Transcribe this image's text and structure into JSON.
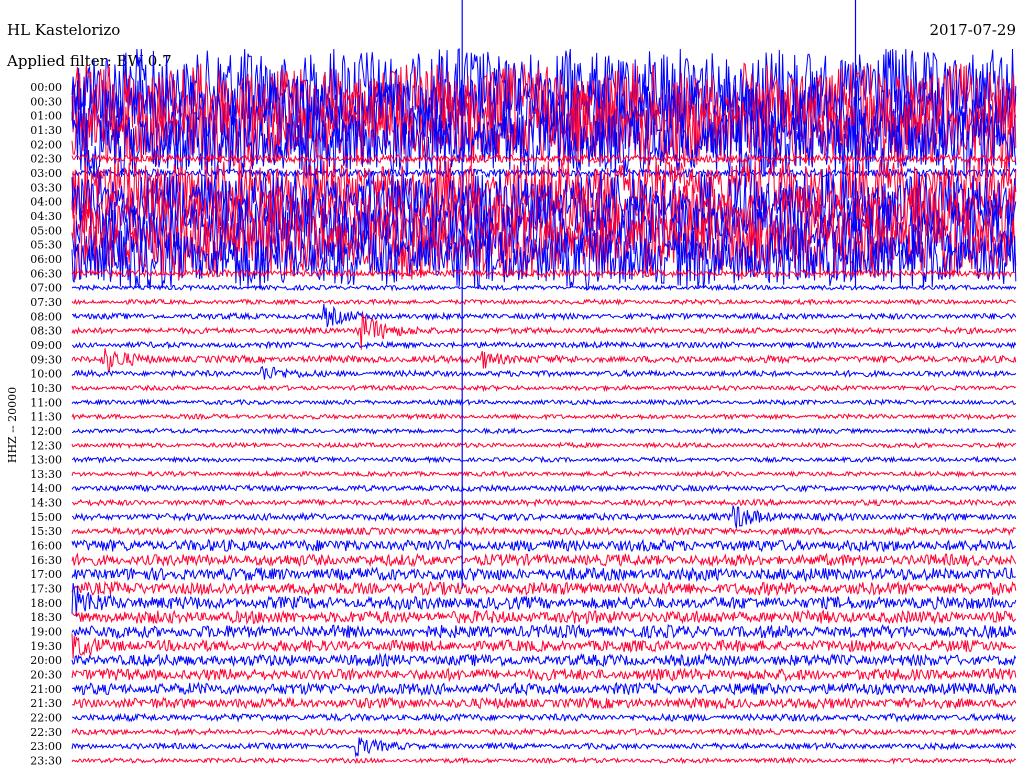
{
  "header": {
    "station": "HL Kastelorizo",
    "date": "2017-07-29",
    "filter_label": "Applied filter: BW 0.7"
  },
  "chart_data": {
    "type": "line",
    "title": "HL Kastelorizo",
    "date": "2017-07-29",
    "ylabel": "HHZ -- 20000",
    "row_interval_minutes": 30,
    "colors": {
      "even_rows": "#0000ff",
      "odd_rows": "#ff0033"
    },
    "grid": false,
    "rows": [
      {
        "time": "00:00",
        "amplitude": 3.5
      },
      {
        "time": "00:30",
        "amplitude": 3.2
      },
      {
        "time": "01:00",
        "amplitude": 3.4
      },
      {
        "time": "01:30",
        "amplitude": 3.3
      },
      {
        "time": "02:00",
        "amplitude": 3.0
      },
      {
        "time": "02:30",
        "amplitude": 0.35
      },
      {
        "time": "03:00",
        "amplitude": 0.35
      },
      {
        "time": "03:30",
        "amplitude": 2.5
      },
      {
        "time": "04:00",
        "amplitude": 2.8
      },
      {
        "time": "04:30",
        "amplitude": 2.6
      },
      {
        "time": "05:00",
        "amplitude": 2.9
      },
      {
        "time": "05:30",
        "amplitude": 3.0
      },
      {
        "time": "06:00",
        "amplitude": 2.6
      },
      {
        "time": "06:30",
        "amplitude": 0.3
      },
      {
        "time": "07:00",
        "amplitude": 0.2
      },
      {
        "time": "07:30",
        "amplitude": 0.2
      },
      {
        "time": "08:00",
        "amplitude": 0.25
      },
      {
        "time": "08:30",
        "amplitude": 0.25
      },
      {
        "time": "09:00",
        "amplitude": 0.25
      },
      {
        "time": "09:30",
        "amplitude": 0.3
      },
      {
        "time": "10:00",
        "amplitude": 0.25
      },
      {
        "time": "10:30",
        "amplitude": 0.2
      },
      {
        "time": "11:00",
        "amplitude": 0.2
      },
      {
        "time": "11:30",
        "amplitude": 0.2
      },
      {
        "time": "12:00",
        "amplitude": 0.2
      },
      {
        "time": "12:30",
        "amplitude": 0.2
      },
      {
        "time": "13:00",
        "amplitude": 0.2
      },
      {
        "time": "13:30",
        "amplitude": 0.2
      },
      {
        "time": "14:00",
        "amplitude": 0.25
      },
      {
        "time": "14:30",
        "amplitude": 0.25
      },
      {
        "time": "15:00",
        "amplitude": 0.3
      },
      {
        "time": "15:30",
        "amplitude": 0.3
      },
      {
        "time": "16:00",
        "amplitude": 0.5
      },
      {
        "time": "16:30",
        "amplitude": 0.5
      },
      {
        "time": "17:00",
        "amplitude": 0.55
      },
      {
        "time": "17:30",
        "amplitude": 0.55
      },
      {
        "time": "18:00",
        "amplitude": 0.55
      },
      {
        "time": "18:30",
        "amplitude": 0.55
      },
      {
        "time": "19:00",
        "amplitude": 0.55
      },
      {
        "time": "19:30",
        "amplitude": 0.5
      },
      {
        "time": "20:00",
        "amplitude": 0.5
      },
      {
        "time": "20:30",
        "amplitude": 0.5
      },
      {
        "time": "21:00",
        "amplitude": 0.5
      },
      {
        "time": "21:30",
        "amplitude": 0.45
      },
      {
        "time": "22:00",
        "amplitude": 0.3
      },
      {
        "time": "22:30",
        "amplitude": 0.25
      },
      {
        "time": "23:00",
        "amplitude": 0.25
      },
      {
        "time": "23:30",
        "amplitude": 0.2
      }
    ],
    "events": [
      {
        "row": "08:00",
        "minute": 8,
        "amplitude": 1.0
      },
      {
        "row": "08:30",
        "minute": 9,
        "amplitude": 2.4
      },
      {
        "row": "09:30",
        "minute": 1,
        "amplitude": 1.2
      },
      {
        "row": "09:30",
        "minute": 13,
        "amplitude": 0.8
      },
      {
        "row": "10:00",
        "minute": 6,
        "amplitude": 0.8
      },
      {
        "row": "15:00",
        "minute": 21,
        "amplitude": 1.2
      },
      {
        "row": "18:00",
        "minute": 0,
        "amplitude": 1.4
      },
      {
        "row": "19:30",
        "minute": 0,
        "amplitude": 0.8
      },
      {
        "row": "23:00",
        "minute": 9,
        "amplitude": 0.9
      }
    ],
    "spikes": [
      {
        "minute": 12.4,
        "from": "00:00",
        "to": "17:30"
      },
      {
        "minute": 24.9,
        "from": "00:00",
        "to": "07:00"
      }
    ]
  }
}
